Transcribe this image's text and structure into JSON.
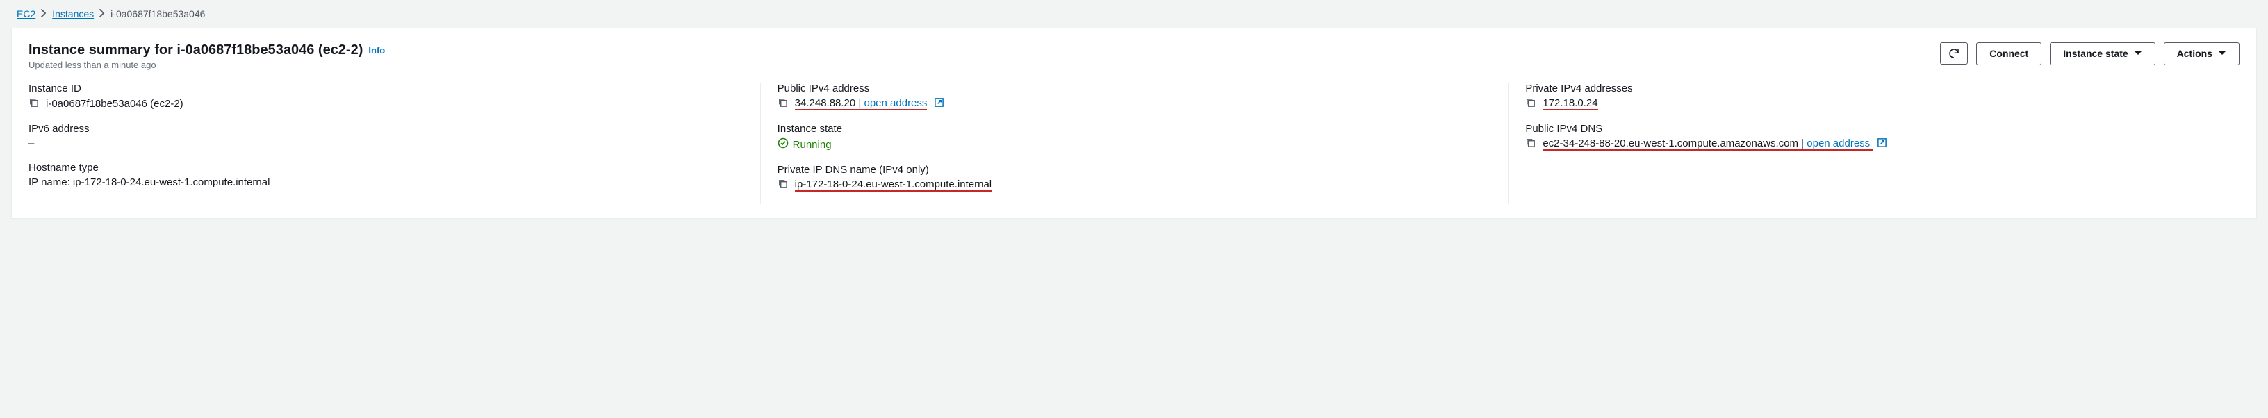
{
  "breadcrumb": {
    "ec2": "EC2",
    "instances": "Instances",
    "current": "i-0a0687f18be53a046"
  },
  "header": {
    "title": "Instance summary for i-0a0687f18be53a046 (ec2-2)",
    "info": "Info",
    "subtitle": "Updated less than a minute ago"
  },
  "buttons": {
    "connect": "Connect",
    "instance_state": "Instance state",
    "actions": "Actions"
  },
  "fields": {
    "instance_id": {
      "label": "Instance ID",
      "value": "i-0a0687f18be53a046 (ec2-2)"
    },
    "ipv6": {
      "label": "IPv6 address",
      "value": "–"
    },
    "hostname_type": {
      "label": "Hostname type",
      "value": "IP name: ip-172-18-0-24.eu-west-1.compute.internal"
    },
    "public_ipv4": {
      "label": "Public IPv4 address",
      "value": "34.248.88.20",
      "open": "open address"
    },
    "instance_state": {
      "label": "Instance state",
      "value": "Running"
    },
    "private_dns": {
      "label": "Private IP DNS name (IPv4 only)",
      "value": "ip-172-18-0-24.eu-west-1.compute.internal"
    },
    "private_ipv4": {
      "label": "Private IPv4 addresses",
      "value": "172.18.0.24"
    },
    "public_dns": {
      "label": "Public IPv4 DNS",
      "value": "ec2-34-248-88-20.eu-west-1.compute.amazonaws.com",
      "open": "open address"
    }
  }
}
